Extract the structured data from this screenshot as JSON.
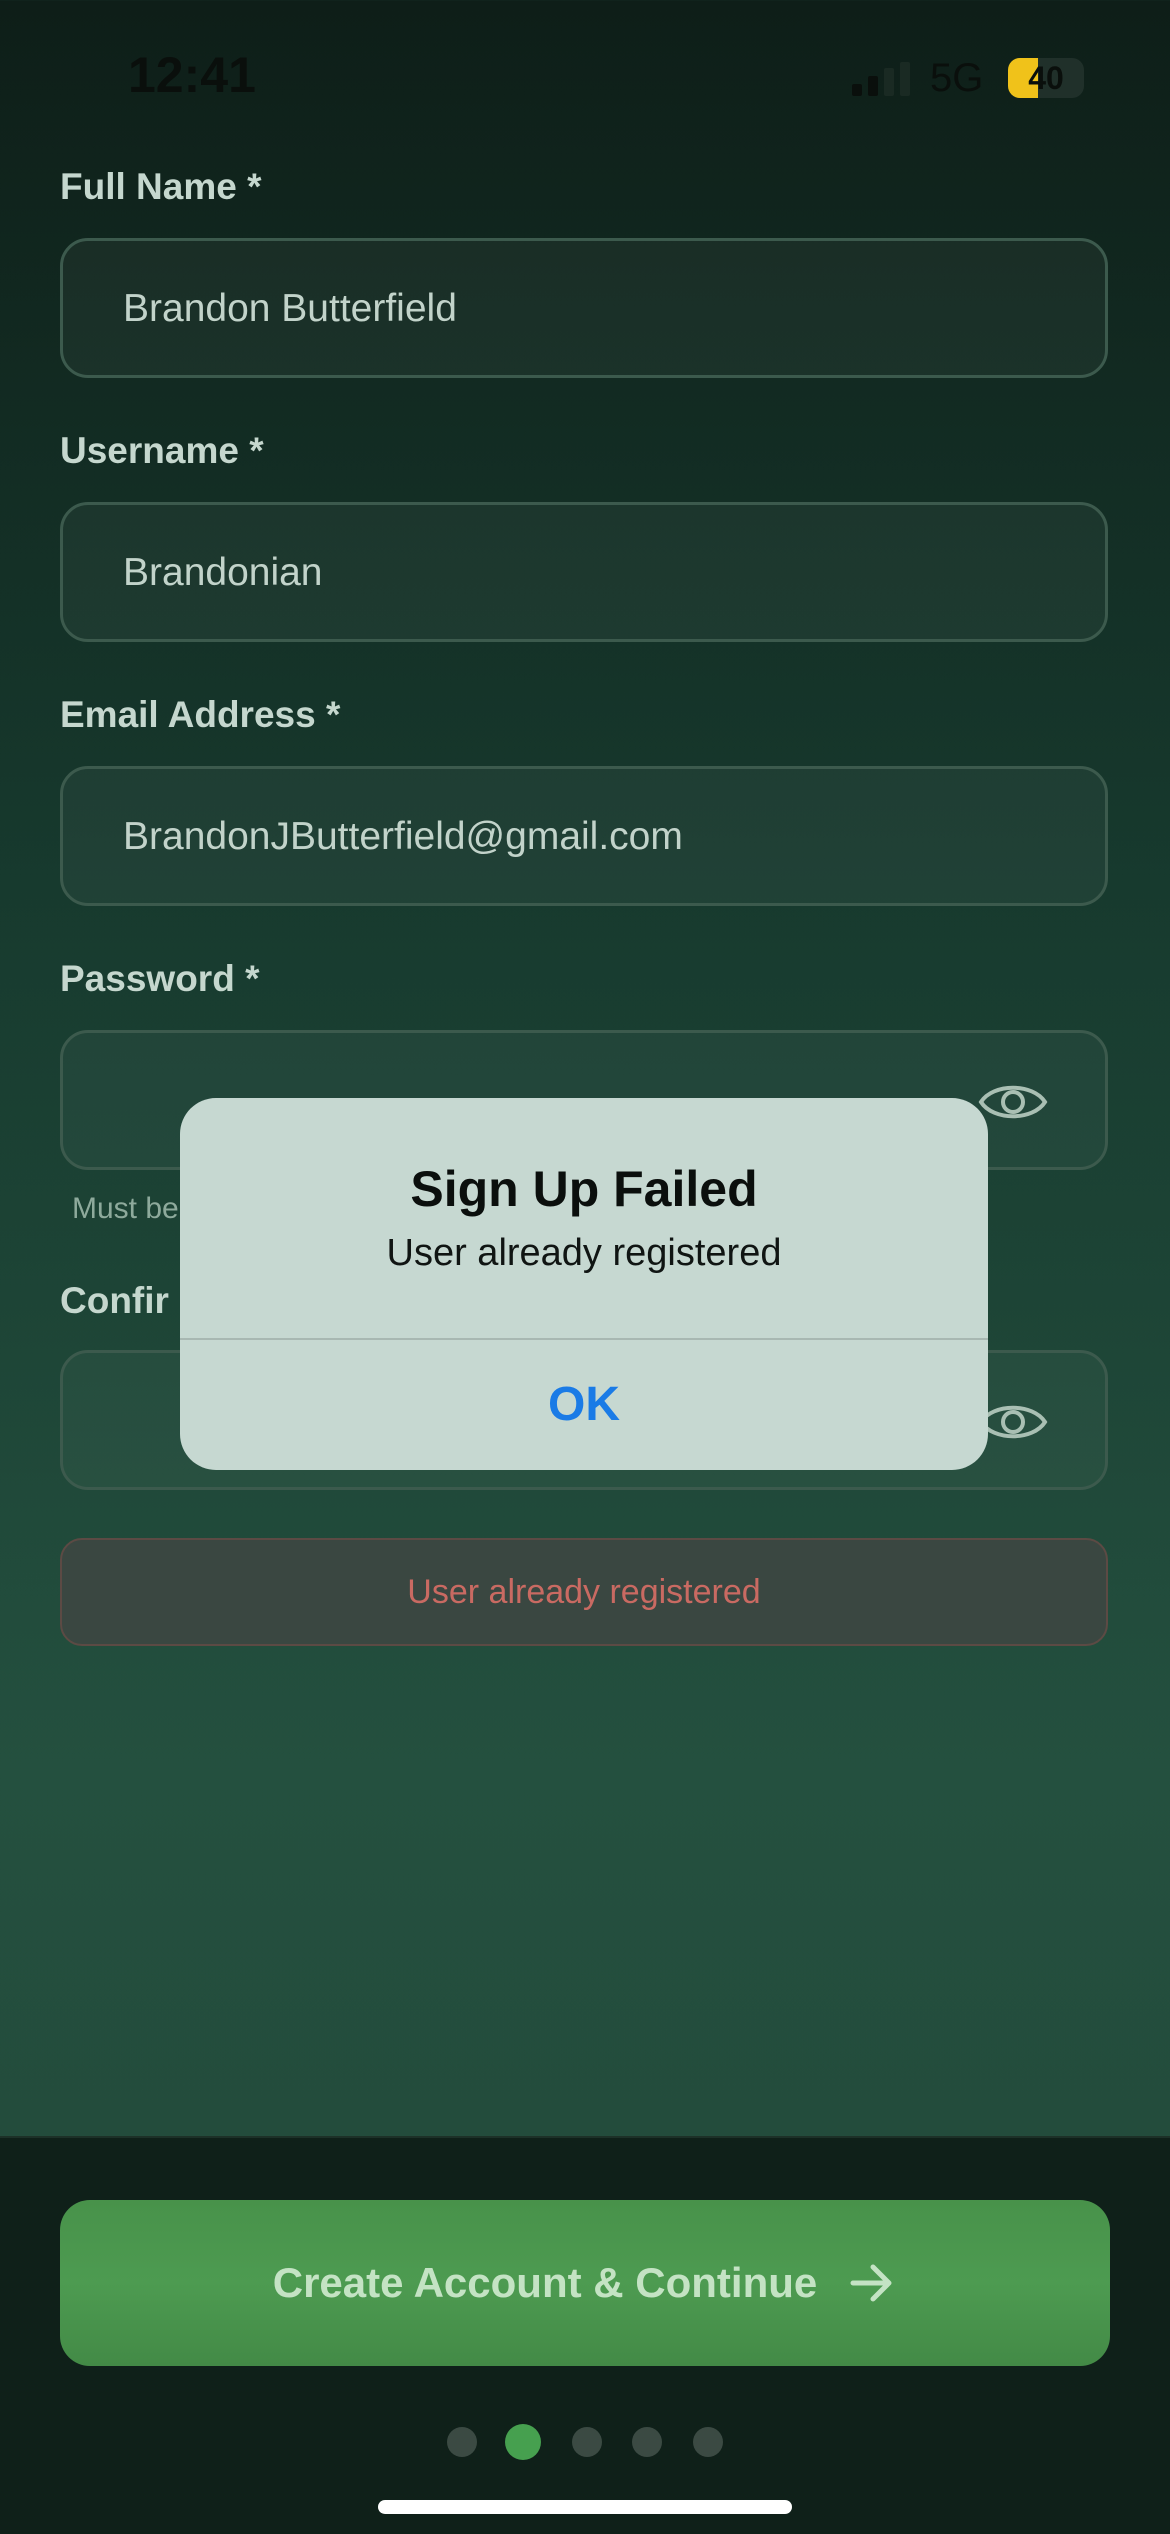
{
  "status_bar": {
    "time": "12:41",
    "network": "5G",
    "battery": "40",
    "battery_level": 0.4
  },
  "form": {
    "full_name": {
      "label": "Full Name *",
      "value": "Brandon Butterfield"
    },
    "username": {
      "label": "Username *",
      "value": "Brandonian"
    },
    "email": {
      "label": "Email Address *",
      "value": "BrandonJButterfield@gmail.com"
    },
    "password": {
      "label": "Password *",
      "value": "",
      "hint": "Must be"
    },
    "confirm_password": {
      "label": "Confir",
      "value": ""
    },
    "error_message": "User already registered"
  },
  "dialog": {
    "title": "Sign Up Failed",
    "message": "User already registered",
    "ok_label": "OK"
  },
  "footer": {
    "cta_label": "Create Account & Continue",
    "cta_icon": "arrow-right-icon",
    "page_dots": 5,
    "active_dot": 2
  },
  "colors": {
    "accent_green": "#46a04f",
    "error_text": "#c96a62",
    "dialog_link": "#1a7be6"
  }
}
